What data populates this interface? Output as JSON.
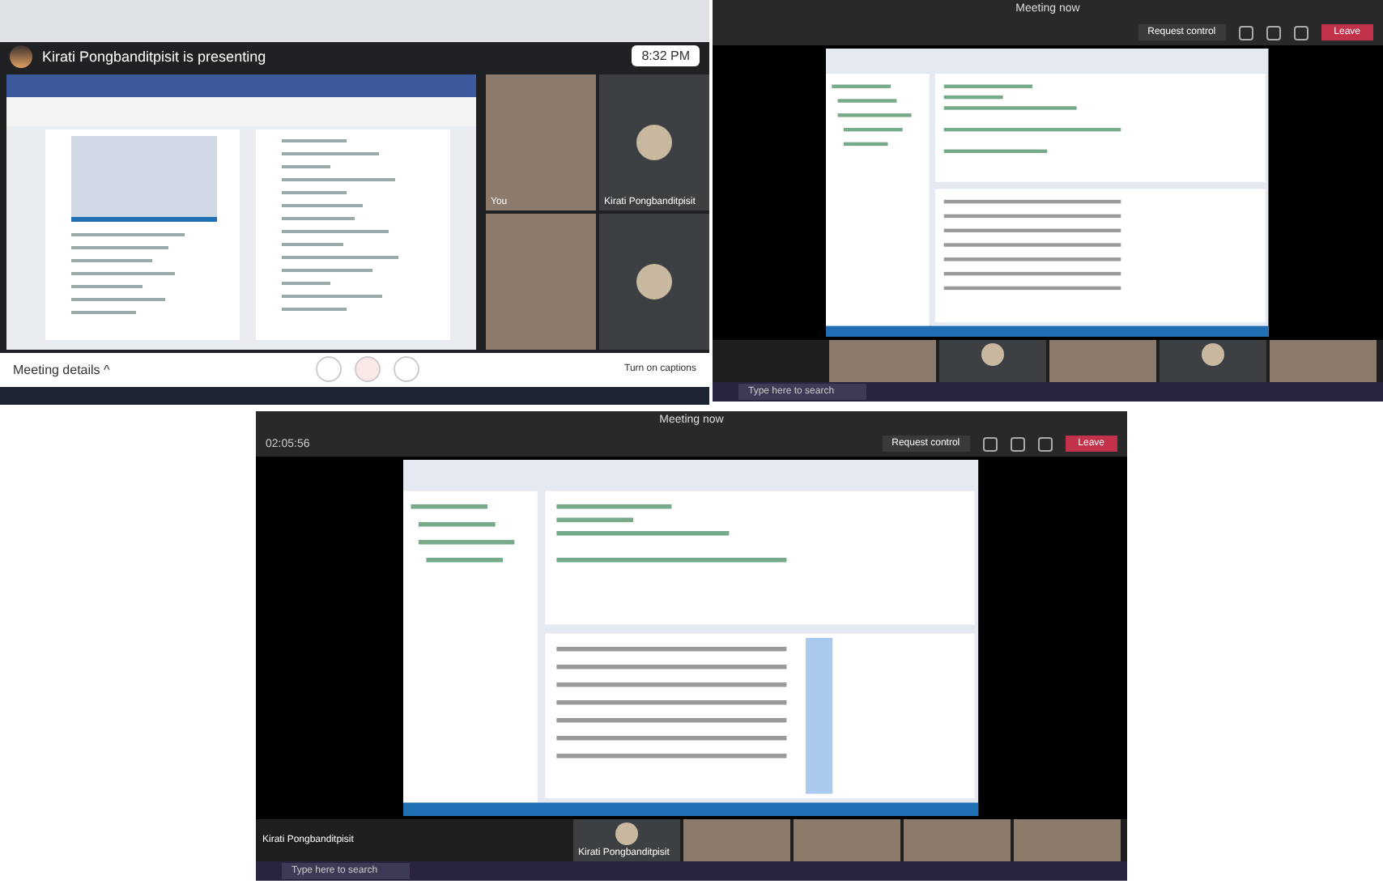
{
  "screens": [
    {
      "kind": "meet",
      "presenting": "Kirati Pongbanditpisit is presenting",
      "time": "8:32 PM",
      "details": "Meeting details",
      "caret": "^",
      "captions": "Turn on captions",
      "tiles": [
        {
          "kind": "video",
          "name": "You"
        },
        {
          "kind": "avatar",
          "name": "Kirati Pongbanditpisit"
        },
        {
          "kind": "video"
        },
        {
          "kind": "avatar"
        }
      ]
    },
    {
      "kind": "teams",
      "title": "Meeting now",
      "request": "Request control",
      "leave": "Leave",
      "search": "Type here to search",
      "tiles": [
        {
          "kind": "video"
        },
        {
          "kind": "avatar"
        },
        {
          "kind": "video"
        },
        {
          "kind": "avatar"
        },
        {
          "kind": "video"
        }
      ]
    },
    {
      "kind": "teams",
      "title": "Meeting now",
      "time": "02:05:56",
      "request": "Request control",
      "leave": "Leave",
      "presenter": "Kirati Pongbanditpisit",
      "search": "Type here to search",
      "tiles": [
        {
          "kind": "avatar",
          "name": "Kirati Pongbanditpisit"
        },
        {
          "kind": "video"
        },
        {
          "kind": "video"
        },
        {
          "kind": "video"
        },
        {
          "kind": "video"
        }
      ]
    }
  ]
}
